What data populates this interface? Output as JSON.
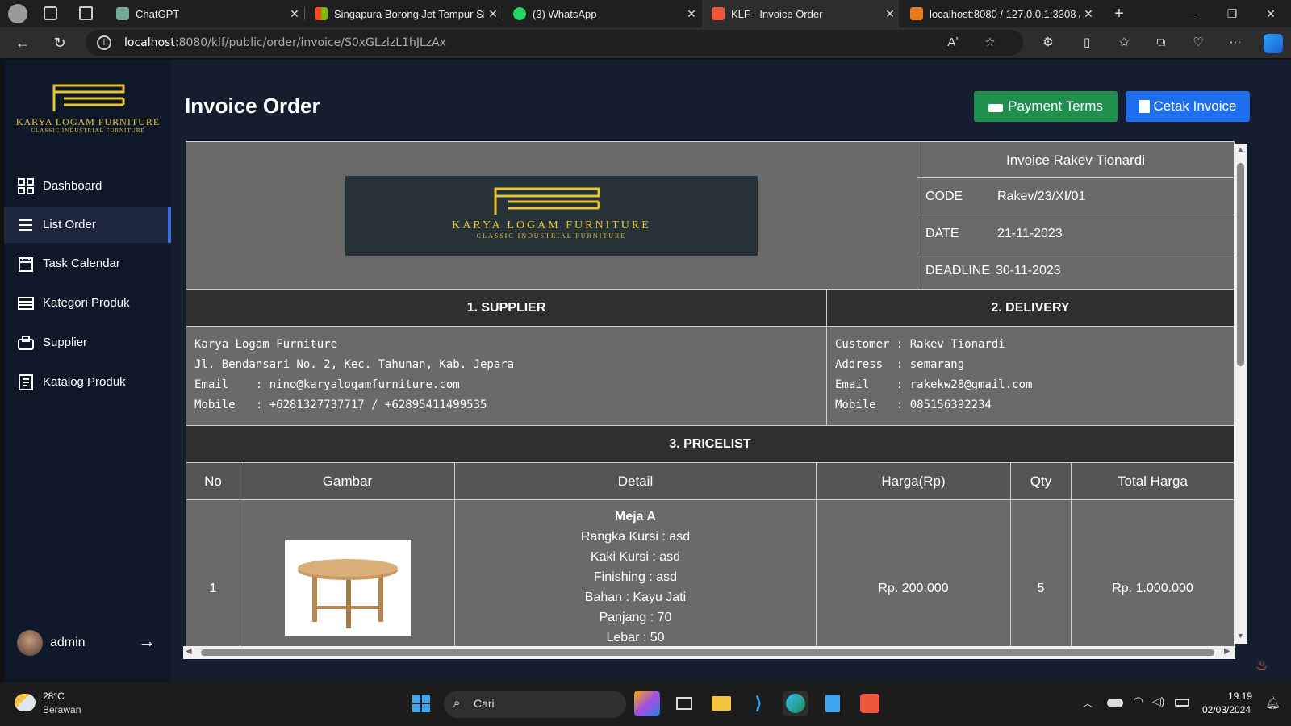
{
  "browser": {
    "tabs": [
      {
        "title": "ChatGPT",
        "color": "#74aa9c"
      },
      {
        "title": "Singapura Borong Jet Tempur Si",
        "color": "#f25022"
      },
      {
        "title": "(3) WhatsApp",
        "color": "#25d366"
      },
      {
        "title": "KLF - Invoice Order",
        "color": "#f0573a",
        "active": true
      },
      {
        "title": "localhost:8080 / 127.0.0.1:3308 /",
        "color": "#e87a22"
      }
    ],
    "url_host": "localhost",
    "url_rest": ":8080/klf/public/order/invoice/S0xGLzlzL1hJLzAx"
  },
  "brand": {
    "name": "KARYA LOGAM FURNITURE",
    "tagline": "CLASSIC INDUSTRIAL FURNITURE",
    "gold": "#e6c52e"
  },
  "sidebar": {
    "items": [
      {
        "label": "Dashboard",
        "icon": "grid-icon"
      },
      {
        "label": "List Order",
        "icon": "list-icon",
        "active": true
      },
      {
        "label": "Task Calendar",
        "icon": "calendar-icon"
      },
      {
        "label": "Kategori Produk",
        "icon": "category-icon"
      },
      {
        "label": "Supplier",
        "icon": "supplier-icon"
      },
      {
        "label": "Katalog Produk",
        "icon": "catalog-icon"
      }
    ],
    "user": "admin"
  },
  "page": {
    "title": "Invoice Order",
    "payment_terms_label": "Payment Terms",
    "cetak_label": "Cetak Invoice"
  },
  "invoice": {
    "title": "Invoice Rakev Tionardi",
    "code_label": "CODE",
    "code": "Rakev/23/XI/01",
    "date_label": "DATE",
    "date": "21-11-2023",
    "deadline_label": "DEADLINE",
    "deadline": "30-11-2023",
    "supplier_header": "1. SUPPLIER",
    "delivery_header": "2. DELIVERY",
    "supplier_lines": [
      "Karya Logam Furniture",
      "Jl. Bendansari No. 2, Kec. Tahunan, Kab. Jepara",
      "Email    : nino@karyalogamfurniture.com",
      "Mobile   : +6281327737717 / +62895411499535"
    ],
    "delivery_lines": [
      "Customer : Rakev Tionardi",
      "Address  : semarang",
      "Email    : rakekw28@gmail.com",
      "Mobile   : 085156392234"
    ],
    "pricelist_header": "3. PRICELIST",
    "columns": [
      "No",
      "Gambar",
      "Detail",
      "Harga(Rp)",
      "Qty",
      "Total Harga"
    ],
    "rows": [
      {
        "no": "1",
        "detail_title": "Meja A",
        "detail_lines": [
          "Rangka Kursi : asd",
          "Kaki Kursi : asd",
          "Finishing : asd",
          "Bahan : Kayu Jati",
          "Panjang : 70",
          "Lebar : 50"
        ],
        "harga": "Rp. 200.000",
        "qty": "5",
        "total": "Rp. 1.000.000"
      }
    ]
  },
  "taskbar": {
    "temp": "28°C",
    "weather": "Berawan",
    "search": "Cari",
    "time": "19.19",
    "date": "02/03/2024"
  },
  "colors": {
    "accent_blue": "#1e6ff0",
    "accent_green": "#1f8f4e"
  }
}
